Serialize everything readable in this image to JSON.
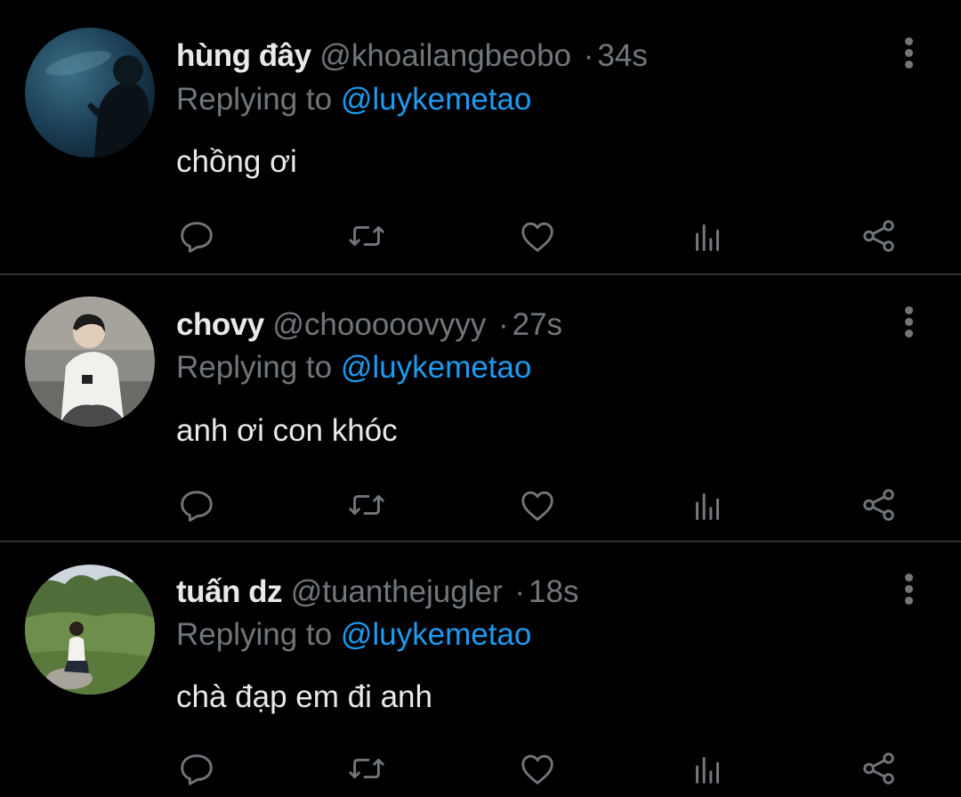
{
  "colors": {
    "background": "#000000",
    "text_primary": "#e7e9ea",
    "text_secondary": "#71767b",
    "mention": "#1d9bf0",
    "divider": "#2f3336"
  },
  "replying_prefix": "Replying to",
  "tweets": [
    {
      "name": "hùng đây",
      "handle": "@khoailangbeobo",
      "separator": "·",
      "time": "34s",
      "reply_to": "@luykemetao",
      "text": "chồng ơi"
    },
    {
      "name": "chovy",
      "handle": "@chooooovyyy",
      "separator": "·",
      "time": "27s",
      "reply_to": "@luykemetao",
      "text": "anh ơi con khóc"
    },
    {
      "name": "tuấn dz",
      "handle": "@tuanthejugler",
      "separator": "·",
      "time": "18s",
      "reply_to": "@luykemetao",
      "text": "chà đạp em đi anh"
    }
  ],
  "icons": {
    "reply": "reply-icon",
    "retweet": "retweet-icon",
    "like": "heart-icon",
    "analytics": "analytics-icon",
    "share": "share-icon",
    "more": "more-vertical-icon"
  }
}
